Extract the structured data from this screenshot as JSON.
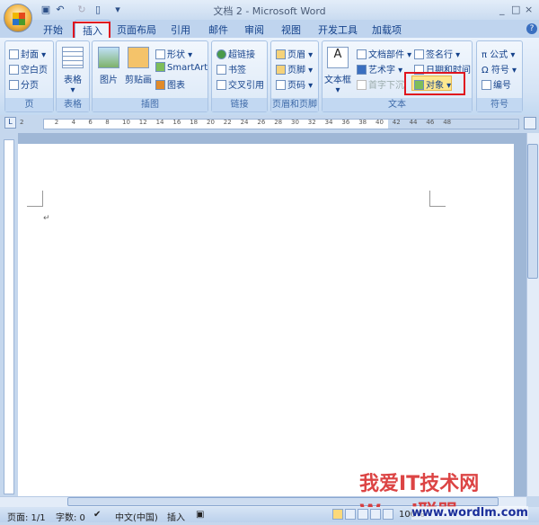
{
  "title": "文档 2 - Microsoft Word",
  "quick_access": [
    "save-icon",
    "undo-icon",
    "redo-icon",
    "new-icon",
    "customize-icon"
  ],
  "window_controls": [
    "_",
    "□",
    "×"
  ],
  "tabs": [
    "开始",
    "插入",
    "页面布局",
    "引用",
    "邮件",
    "审阅",
    "视图",
    "开发工具",
    "加载项"
  ],
  "help": "?",
  "groups": {
    "page": {
      "label": "页",
      "items": [
        "封面",
        "空白页",
        "分页"
      ]
    },
    "table": {
      "label": "表格",
      "items": [
        "表格"
      ]
    },
    "illustrations": {
      "label": "插图",
      "items": [
        "图片",
        "剪贴画",
        "形状",
        "SmartArt",
        "图表"
      ]
    },
    "links": {
      "label": "链接",
      "items": [
        "超链接",
        "书签",
        "交叉引用"
      ]
    },
    "header_footer": {
      "label": "页眉和页脚",
      "items": [
        "页眉",
        "页脚",
        "页码"
      ]
    },
    "text": {
      "label": "文本",
      "items": [
        "文本框",
        "文档部件",
        "艺术字",
        "首字下沉",
        "签名行",
        "日期和时间",
        "对象"
      ]
    },
    "symbols": {
      "label": "符号",
      "items": [
        "公式",
        "符号",
        "编号"
      ]
    }
  },
  "ruler": [
    "2",
    "2",
    "4",
    "6",
    "8",
    "10",
    "12",
    "14",
    "16",
    "18",
    "20",
    "22",
    "24",
    "26",
    "28",
    "30",
    "32",
    "34",
    "36",
    "38",
    "40",
    "42",
    "44",
    "46",
    "48"
  ],
  "status": {
    "page": "页面: 1/1",
    "words": "字数: 0",
    "lang": "中文(中国)",
    "mode": "插入",
    "zoom": "100%"
  },
  "watermark": {
    "text": "我爱IT技术网 Word联盟",
    "url": "www.wordlm.com"
  }
}
